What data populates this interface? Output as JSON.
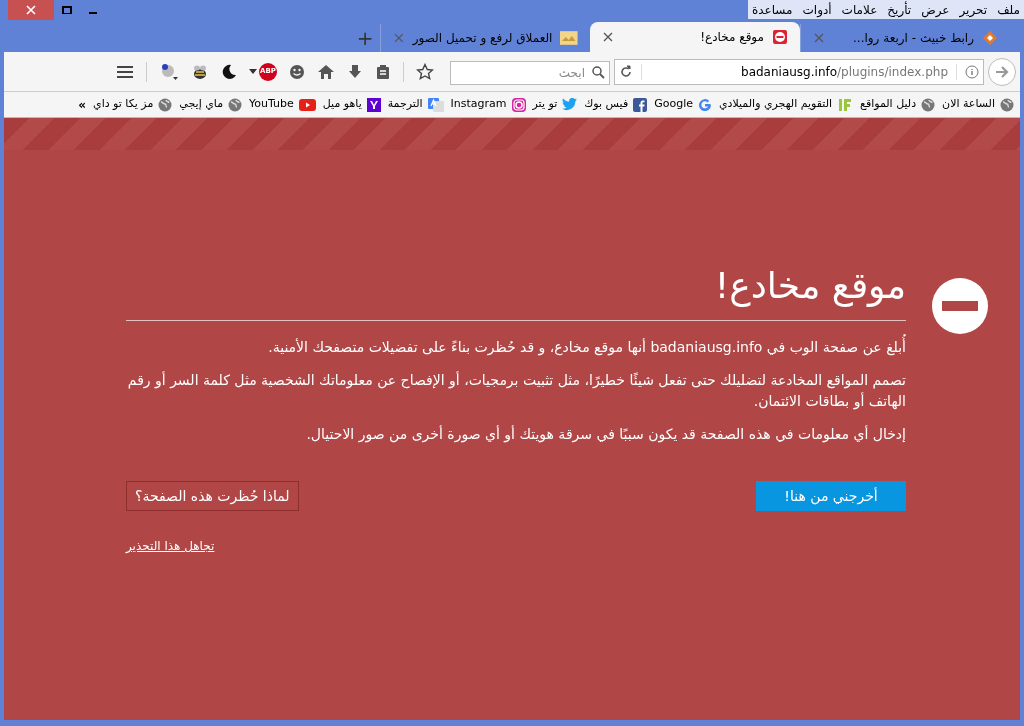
{
  "menu": [
    "ملف",
    "تحرير",
    "عرض",
    "تأريخ",
    "علامات",
    "أدوات",
    "مساعدة"
  ],
  "tabs": [
    {
      "title": "رابط خبيث - اربعة روا...",
      "selected": false,
      "kind": "diamond"
    },
    {
      "title": "موقع مخادع!",
      "selected": true,
      "kind": "block"
    },
    {
      "title": "العملاق لرفع و تحميل الصور",
      "selected": false,
      "kind": "image"
    }
  ],
  "new_tab": "+",
  "url": {
    "host": "badaniausg.info",
    "path": "/plugins/index.php"
  },
  "search": {
    "placeholder": "ابحث"
  },
  "bookmarks": [
    {
      "label": "الساعة الان",
      "kind": "globe"
    },
    {
      "label": "دليل المواقع",
      "kind": "globe"
    },
    {
      "label": "التقويم الهجري والميلادي",
      "kind": "if"
    },
    {
      "label": "Google",
      "kind": "google"
    },
    {
      "label": "فيس بوك",
      "kind": "facebook"
    },
    {
      "label": "تو يتر",
      "kind": "twitter"
    },
    {
      "label": "Instagram",
      "kind": "instagram"
    },
    {
      "label": "الترجمة",
      "kind": "translate"
    },
    {
      "label": "ياهو ميل",
      "kind": "yahoo"
    },
    {
      "label": "YouTube",
      "kind": "youtube"
    },
    {
      "label": "ماي إيجي",
      "kind": "globe"
    },
    {
      "label": "مز يكا تو داي",
      "kind": "globe"
    }
  ],
  "bookmarks_more": "»",
  "abp": "ABP",
  "warning": {
    "title": "موقع مخادع!",
    "paragraphs": [
      "أُبلغ عن صفحة الوب في badaniausg.info أنها موقع مخادع، و قد حُظرت بناءً على تفضيلات متصفحك الأمنية.",
      "تصمم المواقع المخادعة لتضليلك حتى تفعل شيئًا خطيرًا، مثل تثبيت برمجيات، أو الإفصاح عن معلوماتك الشخصية مثل كلمة السر أو رقم الهاتف أو بطاقات الائتمان.",
      "إدخال أي معلومات في هذه الصفحة قد يكون سببًا في سرقة هويتك أو أي صورة أخرى من صور الاحتيال."
    ],
    "primary_button": "أخرجني من هنا!",
    "secondary_button": "لماذا حُظرت هذه الصفحة؟",
    "ignore_link": "تجاهل هذا التحذير"
  }
}
